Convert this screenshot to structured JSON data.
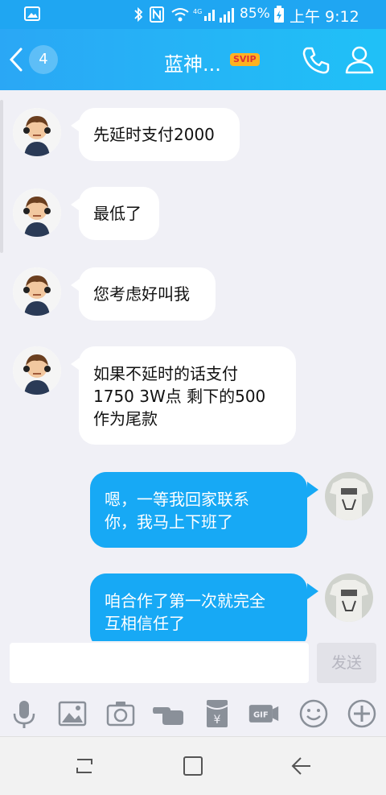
{
  "status_bar": {
    "battery": "85%",
    "time": "上午 9:12"
  },
  "header": {
    "unread_count": "4",
    "contact_name": "蓝神...",
    "badge": "SVIP"
  },
  "messages": [
    {
      "side": "in",
      "text": "先延时支付2000"
    },
    {
      "side": "in",
      "text": "最低了"
    },
    {
      "side": "in",
      "text": "您考虑好叫我"
    },
    {
      "side": "in",
      "lines": [
        "如果不延时的话支付",
        "1750 3W点 剩下的500",
        "作为尾款"
      ]
    },
    {
      "side": "out",
      "lines": [
        "嗯，一等我回家联系",
        "你，我马上下班了"
      ]
    },
    {
      "side": "out",
      "lines": [
        "咱合作了第一次就完全",
        "互相信任了"
      ]
    }
  ],
  "composer": {
    "input_value": "",
    "send_label": "发送"
  },
  "toolbar": {
    "icons": [
      "microphone-icon",
      "image-icon",
      "camera-icon",
      "hand-icon",
      "red-packet-icon",
      "gif-icon",
      "emoji-icon",
      "plus-icon"
    ]
  },
  "colors": {
    "accent": "#1fa6f2",
    "bubble_out": "#17a9f5",
    "badge": "#ffb21f"
  }
}
